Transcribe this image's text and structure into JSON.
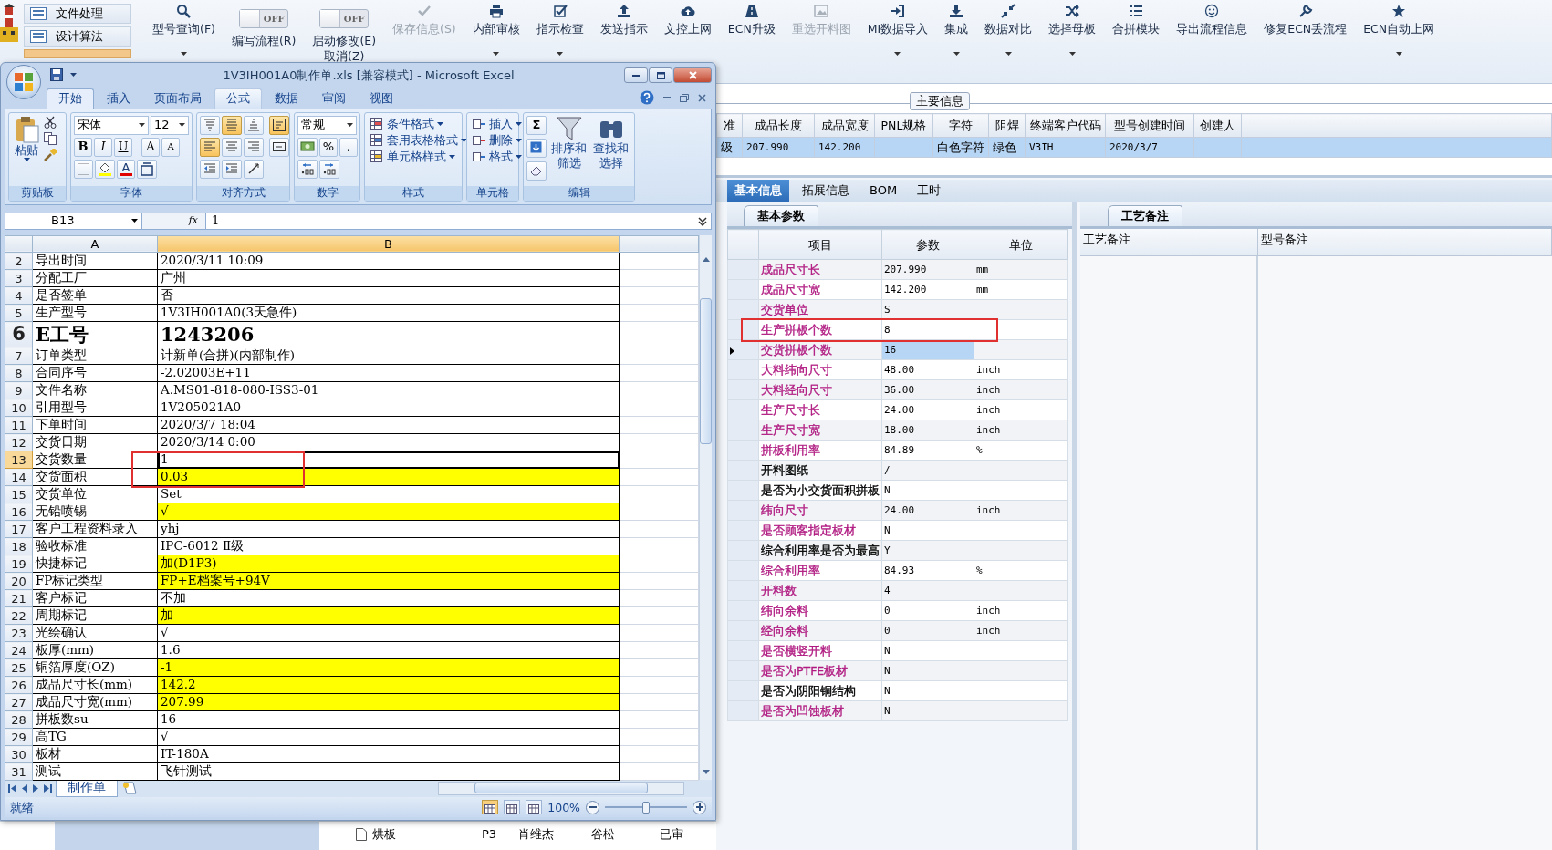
{
  "app": {
    "sidebar": [
      {
        "label": "文件处理"
      },
      {
        "label": "设计算法"
      }
    ],
    "toolbar": [
      {
        "kind": "button",
        "label": "型号查询(F)",
        "disabled": false,
        "has_menu": true
      },
      {
        "kind": "toggle",
        "label": "编写流程(R)",
        "toggle_text": "OFF",
        "on": false
      },
      {
        "kind": "toggle",
        "label": "启动修改(E)",
        "sublabel": "取消(Z)",
        "toggle_text": "OFF",
        "on": false
      },
      {
        "kind": "button",
        "label": "保存信息(S)",
        "disabled": true,
        "has_menu": false
      },
      {
        "kind": "button",
        "label": "内部审核",
        "disabled": false,
        "has_menu": true
      },
      {
        "kind": "button",
        "label": "指示检查",
        "disabled": false,
        "has_menu": true
      },
      {
        "kind": "button",
        "label": "发送指示",
        "disabled": false,
        "has_menu": false
      },
      {
        "kind": "button",
        "label": "文控上网",
        "disabled": false,
        "has_menu": false
      },
      {
        "kind": "button",
        "label": "ECN升级",
        "disabled": false,
        "has_menu": false
      },
      {
        "kind": "button",
        "label": "重选开料图",
        "disabled": true,
        "has_menu": false
      },
      {
        "kind": "button",
        "label": "MI数据导入",
        "disabled": false,
        "has_menu": true
      },
      {
        "kind": "button",
        "label": "集成",
        "disabled": false,
        "has_menu": true
      },
      {
        "kind": "button",
        "label": "数据对比",
        "disabled": false,
        "has_menu": true
      },
      {
        "kind": "button",
        "label": "选择母板",
        "disabled": false,
        "has_menu": true
      },
      {
        "kind": "button",
        "label": "合拼模块",
        "disabled": false,
        "has_menu": false
      },
      {
        "kind": "button",
        "label": "导出流程信息",
        "disabled": false,
        "has_menu": false
      },
      {
        "kind": "button",
        "label": "修复ECN丢流程",
        "disabled": false,
        "has_menu": false
      },
      {
        "kind": "button",
        "label": "ECN自动上网",
        "disabled": false,
        "has_menu": true
      }
    ]
  },
  "main_info": {
    "title": "主要信息",
    "columns": [
      "准",
      "成品长度",
      "成品宽度",
      "PNL规格",
      "字符",
      "阻焊",
      "终端客户代码",
      "型号创建时间",
      "创建人"
    ],
    "rows": [
      {
        "selected": true,
        "cells": [
          "级",
          "207.990",
          "142.200",
          null,
          "白色字符",
          "绿色",
          "V3IH",
          "2020/3/7",
          null
        ]
      }
    ]
  },
  "detail_tabs": [
    {
      "label": "基本信息",
      "selected": true
    },
    {
      "label": "拓展信息",
      "selected": false
    },
    {
      "label": "BOM",
      "selected": false
    },
    {
      "label": "工时",
      "selected": false
    }
  ],
  "basic_params": {
    "tab": "基本参数",
    "columns": [
      "项目",
      "参数",
      "单位"
    ],
    "rows": [
      {
        "item": "成品尺寸长",
        "value": "207.990",
        "unit": "mm",
        "color": "#b01a80",
        "selected": false,
        "highlighted": false
      },
      {
        "item": "成品尺寸宽",
        "value": "142.200",
        "unit": "mm",
        "color": "#b01a80",
        "selected": false,
        "highlighted": false
      },
      {
        "item": "交货单位",
        "value": "S",
        "color": "#b01a80",
        "selected": false,
        "highlighted": false
      },
      {
        "item": "生产拼板个数",
        "value": "8",
        "color": "#b01a80",
        "selected": false,
        "highlighted": true
      },
      {
        "item": "交货拼板个数",
        "value": "16",
        "color": "#b01a80",
        "selected": true,
        "highlighted": false
      },
      {
        "item": "大料纬向尺寸",
        "value": "48.00",
        "unit": "inch",
        "color": "#b01a80",
        "selected": false,
        "highlighted": false
      },
      {
        "item": "大料经向尺寸",
        "value": "36.00",
        "unit": "inch",
        "color": "#b01a80",
        "selected": false,
        "highlighted": false
      },
      {
        "item": "生产尺寸长",
        "value": "24.00",
        "unit": "inch",
        "color": "#b01a80",
        "selected": false,
        "highlighted": false
      },
      {
        "item": "生产尺寸宽",
        "value": "18.00",
        "unit": "inch",
        "color": "#b01a80",
        "selected": false,
        "highlighted": false
      },
      {
        "item": "拼板利用率",
        "value": "84.89",
        "unit": "%",
        "color": "#b01a80",
        "selected": false,
        "highlighted": false
      },
      {
        "item": "开料图纸",
        "value": "/",
        "color": "#000000",
        "selected": false,
        "highlighted": false
      },
      {
        "item": "是否为小交货面积拼板",
        "value": "N",
        "color": "#000000",
        "selected": false,
        "highlighted": false
      },
      {
        "item": "纬向尺寸",
        "value": "24.00",
        "unit": "inch",
        "color": "#b01a80",
        "selected": false,
        "highlighted": false
      },
      {
        "item": "是否顾客指定板材",
        "value": "N",
        "color": "#b01a80",
        "selected": false,
        "highlighted": false
      },
      {
        "item": "综合利用率是否为最高",
        "value": "Y",
        "color": "#000000",
        "selected": false,
        "highlighted": false
      },
      {
        "item": "综合利用率",
        "value": "84.93",
        "unit": "%",
        "color": "#b01a80",
        "selected": false,
        "highlighted": false
      },
      {
        "item": "开料数",
        "value": "4",
        "color": "#b01a80",
        "selected": false,
        "highlighted": false
      },
      {
        "item": "纬向余料",
        "value": "0",
        "unit": "inch",
        "color": "#b01a80",
        "selected": false,
        "highlighted": false
      },
      {
        "item": "经向余料",
        "value": "0",
        "unit": "inch",
        "color": "#b01a80",
        "selected": false,
        "highlighted": false
      },
      {
        "item": "是否横竖开料",
        "value": "N",
        "color": "#b01a80",
        "selected": false,
        "highlighted": false
      },
      {
        "item": "是否为PTFE板材",
        "value": "N",
        "color": "#b01a80",
        "selected": false,
        "highlighted": false
      },
      {
        "item": "是否为阴阳铜结构",
        "value": "N",
        "color": "#000000",
        "selected": false,
        "highlighted": false
      },
      {
        "item": "是否为凹蚀板材",
        "value": "N",
        "color": "#b01a80",
        "selected": false,
        "highlighted": false
      }
    ]
  },
  "process_notes": {
    "tab": "工艺备注",
    "columns": [
      "工艺备注",
      "型号备注"
    ]
  },
  "lower_grid_row": {
    "cells": [
      "烘板",
      "P3",
      "肖维杰",
      "谷松",
      "已审"
    ]
  },
  "excel": {
    "title": "1V3IH001A0制作单.xls  [兼容模式] - Microsoft Excel",
    "tabs": [
      {
        "label": "开始",
        "selected": true,
        "hovered": false
      },
      {
        "label": "插入",
        "selected": false,
        "hovered": false
      },
      {
        "label": "页面布局",
        "selected": false,
        "hovered": false
      },
      {
        "label": "公式",
        "selected": false,
        "hovered": true
      },
      {
        "label": "数据",
        "selected": false,
        "hovered": false
      },
      {
        "label": "审阅",
        "selected": false,
        "hovered": false
      },
      {
        "label": "视图",
        "selected": false,
        "hovered": false
      }
    ],
    "ribbon": {
      "paste": "粘贴",
      "font_name": "宋体",
      "font_size": "12",
      "font_buttons": [
        "B",
        "I",
        "U"
      ],
      "grow": "A",
      "shrink": "A",
      "font_color": "A",
      "number_format": "常规",
      "percent": "%",
      "comma": ",",
      "styles": [
        "条件格式",
        "套用表格格式",
        "单元格样式"
      ],
      "cells": [
        "插入",
        "删除",
        "格式"
      ],
      "sum": "Σ",
      "sort": [
        "排序和",
        "筛选"
      ],
      "find": [
        "查找和",
        "选择"
      ],
      "alignment": [
        {
          "selected": false
        },
        {
          "selected": true
        },
        {
          "selected": false
        },
        {
          "selected": true
        },
        {
          "selected": true
        },
        {
          "selected": false
        },
        {
          "selected": false
        },
        {
          "selected": false
        }
      ],
      "groups": [
        "剪贴板",
        "字体",
        "对齐方式",
        "数字",
        "样式",
        "单元格",
        "编辑"
      ]
    },
    "name_box": "B13",
    "fx": "fx",
    "formula": "1",
    "columns": [
      {
        "label": "A",
        "selected": false
      },
      {
        "label": "B",
        "selected": true
      }
    ],
    "rows": [
      {
        "n": "2",
        "a": "导出时间",
        "b": "2020/3/11 10:09",
        "kind": "normal",
        "filled": false,
        "selected": false,
        "highlighted": false
      },
      {
        "n": "3",
        "a": "分配工厂",
        "b": "广州",
        "kind": "normal",
        "filled": false,
        "selected": false,
        "highlighted": false
      },
      {
        "n": "4",
        "a": "是否签单",
        "b": "否",
        "kind": "normal",
        "filled": false,
        "selected": false,
        "highlighted": false
      },
      {
        "n": "5",
        "a": "生产型号",
        "b": "1V3IH001A0(3天急件)",
        "kind": "normal",
        "filled": false,
        "selected": false,
        "highlighted": false
      },
      {
        "n": "6",
        "a": "E工号",
        "b": "1243206",
        "kind": "title",
        "filled": false,
        "selected": false,
        "highlighted": false
      },
      {
        "n": "7",
        "a": "订单类型",
        "b": "计新单(合拼)(内部制作)",
        "kind": "normal",
        "filled": false,
        "selected": false,
        "highlighted": false
      },
      {
        "n": "8",
        "a": "合同序号",
        "b": "-2.02003E+11",
        "kind": "normal",
        "filled": false,
        "selected": false,
        "highlighted": false
      },
      {
        "n": "9",
        "a": "文件名称",
        "b": "A.MS01-818-080-ISS3-01",
        "kind": "normal",
        "filled": false,
        "selected": false,
        "highlighted": false
      },
      {
        "n": "10",
        "a": "引用型号",
        "b": "1V205021A0",
        "kind": "normal",
        "filled": false,
        "selected": false,
        "highlighted": false
      },
      {
        "n": "11",
        "a": "下单时间",
        "b": "2020/3/7 18:04",
        "kind": "normal",
        "filled": false,
        "selected": false,
        "highlighted": false
      },
      {
        "n": "12",
        "a": "交货日期",
        "b": "2020/3/14 0:00",
        "kind": "normal",
        "filled": false,
        "selected": false,
        "highlighted": false
      },
      {
        "n": "13",
        "a": "交货数量",
        "b": "1",
        "kind": "normal",
        "filled": false,
        "selected": true,
        "highlighted": true
      },
      {
        "n": "14",
        "a": "交货面积",
        "b": "0.03",
        "kind": "normal",
        "filled": true,
        "selected": false,
        "highlighted": true
      },
      {
        "n": "15",
        "a": "交货单位",
        "b": "Set",
        "kind": "normal",
        "filled": false,
        "selected": false,
        "highlighted": false
      },
      {
        "n": "16",
        "a": "无铅喷锡",
        "b": "√",
        "kind": "normal",
        "filled": true,
        "selected": false,
        "highlighted": false
      },
      {
        "n": "17",
        "a": "客户工程资料录入",
        "b": "yhj",
        "kind": "normal",
        "filled": false,
        "selected": false,
        "highlighted": false
      },
      {
        "n": "18",
        "a": "验收标准",
        "b": "IPC-6012 Ⅱ级",
        "kind": "normal",
        "filled": false,
        "selected": false,
        "highlighted": false
      },
      {
        "n": "19",
        "a": "快捷标记",
        "b": "加(D1P3)",
        "kind": "normal",
        "filled": true,
        "selected": false,
        "highlighted": false
      },
      {
        "n": "20",
        "a": "FP标记类型",
        "b": "FP+E档案号+94V",
        "kind": "normal",
        "filled": true,
        "selected": false,
        "highlighted": false
      },
      {
        "n": "21",
        "a": "客户标记",
        "b": "不加",
        "kind": "normal",
        "filled": false,
        "selected": false,
        "highlighted": false
      },
      {
        "n": "22",
        "a": "周期标记",
        "b": "加",
        "kind": "normal",
        "filled": true,
        "selected": false,
        "highlighted": false
      },
      {
        "n": "23",
        "a": "光绘确认",
        "b": "√",
        "kind": "normal",
        "filled": false,
        "selected": false,
        "highlighted": false
      },
      {
        "n": "24",
        "a": "板厚(mm)",
        "b": "1.6",
        "kind": "normal",
        "filled": false,
        "selected": false,
        "highlighted": false
      },
      {
        "n": "25",
        "a": "铜箔厚度(OZ)",
        "b": "-1",
        "kind": "normal",
        "filled": true,
        "selected": false,
        "highlighted": false
      },
      {
        "n": "26",
        "a": "成品尺寸长(mm)",
        "b": "142.2",
        "kind": "normal",
        "filled": true,
        "selected": false,
        "highlighted": false
      },
      {
        "n": "27",
        "a": "成品尺寸宽(mm)",
        "b": "207.99",
        "kind": "normal",
        "filled": true,
        "selected": false,
        "highlighted": false
      },
      {
        "n": "28",
        "a": "拼板数su",
        "b": "16",
        "kind": "normal",
        "filled": false,
        "selected": false,
        "highlighted": false
      },
      {
        "n": "29",
        "a": "高TG",
        "b": "√",
        "kind": "normal",
        "filled": false,
        "selected": false,
        "highlighted": false
      },
      {
        "n": "30",
        "a": "板材",
        "b": "IT-180A",
        "kind": "normal",
        "filled": false,
        "selected": false,
        "highlighted": false
      },
      {
        "n": "31",
        "a": "测试",
        "b": "飞针测试",
        "kind": "normal",
        "filled": false,
        "selected": false,
        "highlighted": false
      }
    ],
    "sheet_tab": "制作单",
    "status": "就绪",
    "views": [
      {
        "selected": true
      },
      {
        "selected": false
      },
      {
        "selected": false
      }
    ],
    "zoom": "100%",
    "zoom_slider": {
      "level": 0.5
    }
  }
}
